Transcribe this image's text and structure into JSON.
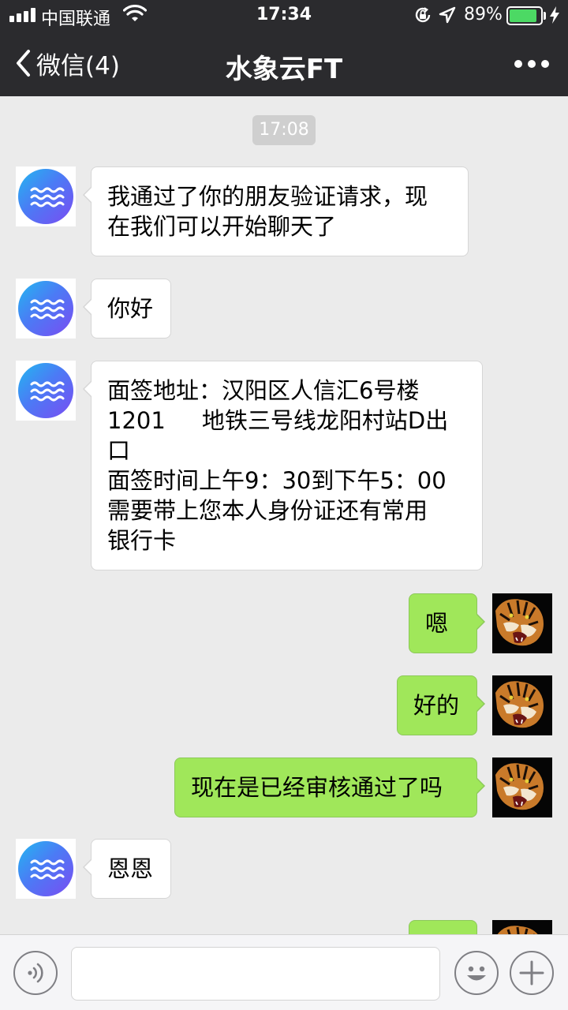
{
  "status_bar": {
    "carrier": "中国联通",
    "time": "17:34",
    "battery_percent": "89%",
    "battery_level": 0.89,
    "icons": [
      "signal-icon",
      "wifi-icon",
      "orientation-lock-icon",
      "location-icon",
      "battery-icon",
      "charging-icon"
    ]
  },
  "nav": {
    "back_label": "微信(4)",
    "title": "水象云FT",
    "more_icon": "more-dots-icon"
  },
  "chat": {
    "timestamp": "17:08",
    "messages": [
      {
        "side": "left",
        "text": "我通过了你的朋友验证请求，现\n在我们可以开始聊天了"
      },
      {
        "side": "left",
        "text": "你好"
      },
      {
        "side": "left",
        "text": "面签地址：汉阳区人信汇6号楼\n1201     地铁三号线龙阳村站D出\n口\n面签时间上午9：30到下午5：00\n需要带上您本人身份证还有常用\n银行卡"
      },
      {
        "side": "right",
        "text": "嗯"
      },
      {
        "side": "right",
        "text": "好的"
      },
      {
        "side": "right",
        "text": "现在是已经审核通过了吗"
      },
      {
        "side": "left",
        "text": "恩恩"
      },
      {
        "side": "right",
        "text": ""
      }
    ]
  },
  "input_bar": {
    "voice_icon": "voice-icon",
    "emoji_icon": "emoji-icon",
    "add_icon": "plus-icon",
    "text_value": ""
  },
  "colors": {
    "nav_bg": "#2b2b2e",
    "chat_bg": "#ebebeb",
    "bubble_right": "#a0e75a",
    "bubble_left": "#ffffff",
    "battery_fill": "#4cd964"
  }
}
